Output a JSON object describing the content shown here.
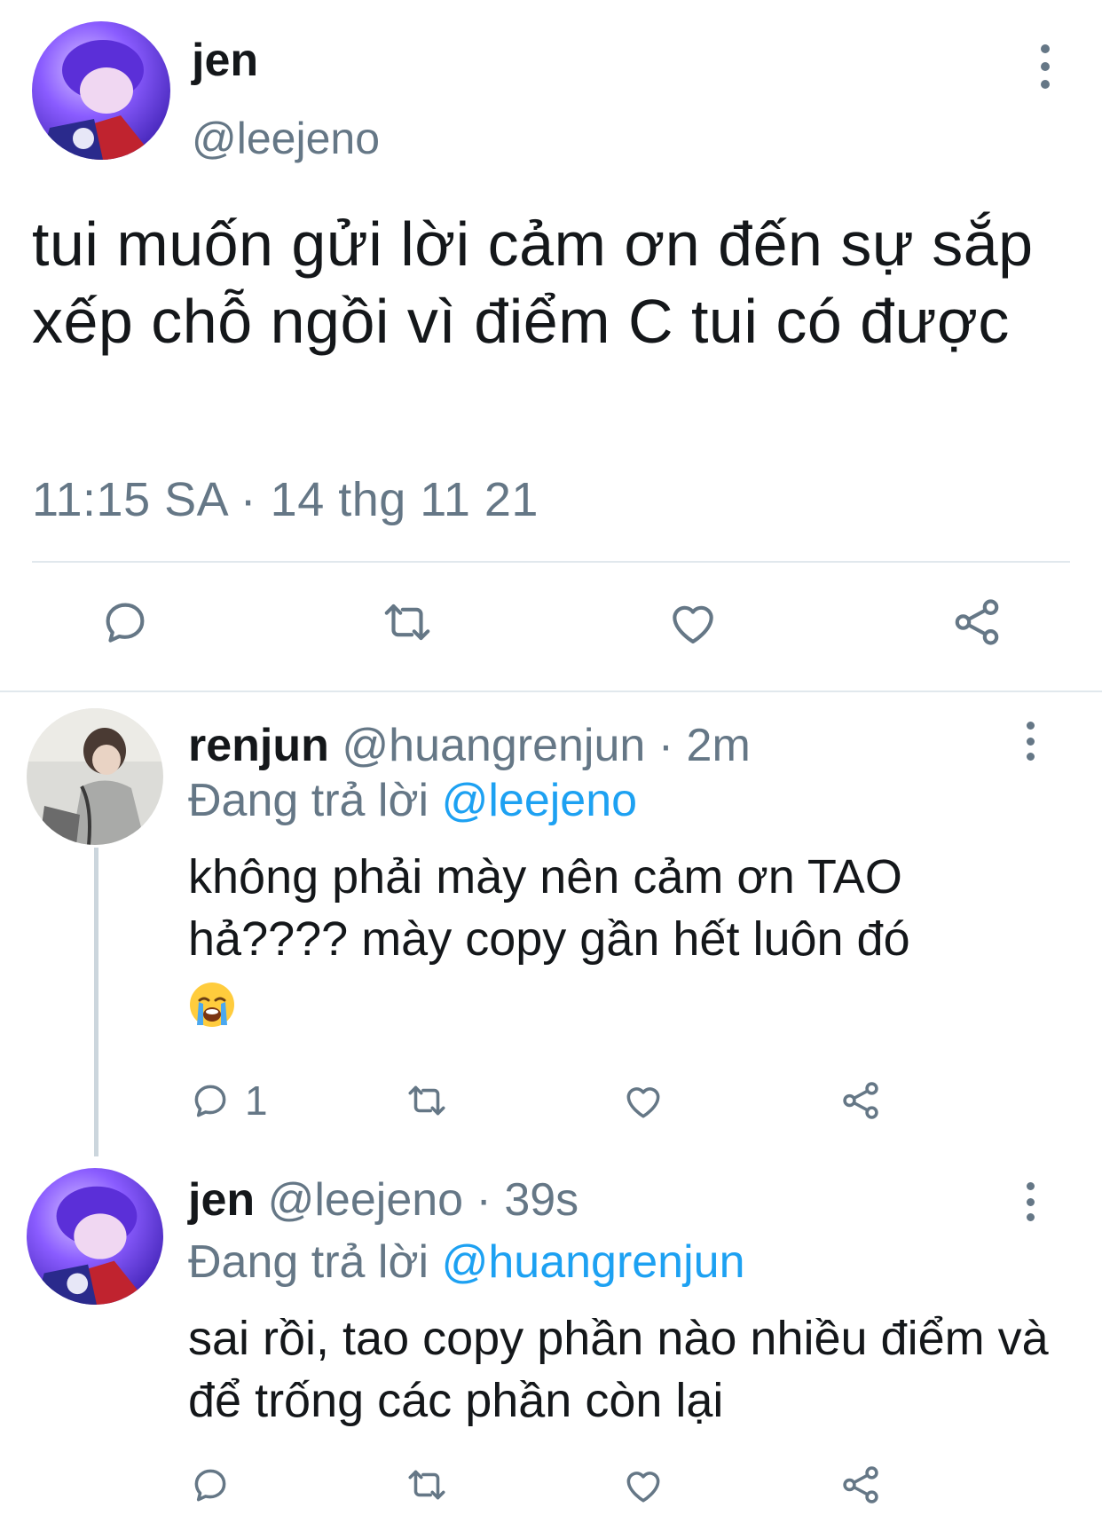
{
  "main_tweet": {
    "name": "jen",
    "handle": "@leejeno",
    "text": "tui muốn gửi lời cảm ơn đến sự sắp xếp chỗ ngồi vì điểm C tui có được",
    "timestamp": "11:15 SA · 14 thg 11 21",
    "actions": [
      "reply-icon",
      "retweet-icon",
      "like-icon",
      "share-icon"
    ]
  },
  "replies": [
    {
      "name": "renjun",
      "handle": "@huangrenjun",
      "time_sep": "·",
      "time": "2m",
      "replying_prefix": "Đang trả lời",
      "replying_to": "@leejeno",
      "text": "không phải mày nên cảm ơn TAO hả???? mày copy gần hết luôn đó",
      "emoji": "loudly-crying-face",
      "reply_count": "1"
    },
    {
      "name": "jen",
      "handle": "@leejeno",
      "time_sep": "·",
      "time": "39s",
      "replying_prefix": "Đang trả lời",
      "replying_to": "@huangrenjun",
      "text": "sai rồi, tao copy phần nào nhiều điểm và để trống các phần còn lại",
      "reply_count": ""
    }
  ],
  "colors": {
    "text": "#14171a",
    "secondary": "#657786",
    "link": "#1da1f2",
    "divider": "#e1e8ed",
    "thread_line": "#ccd6dd"
  }
}
